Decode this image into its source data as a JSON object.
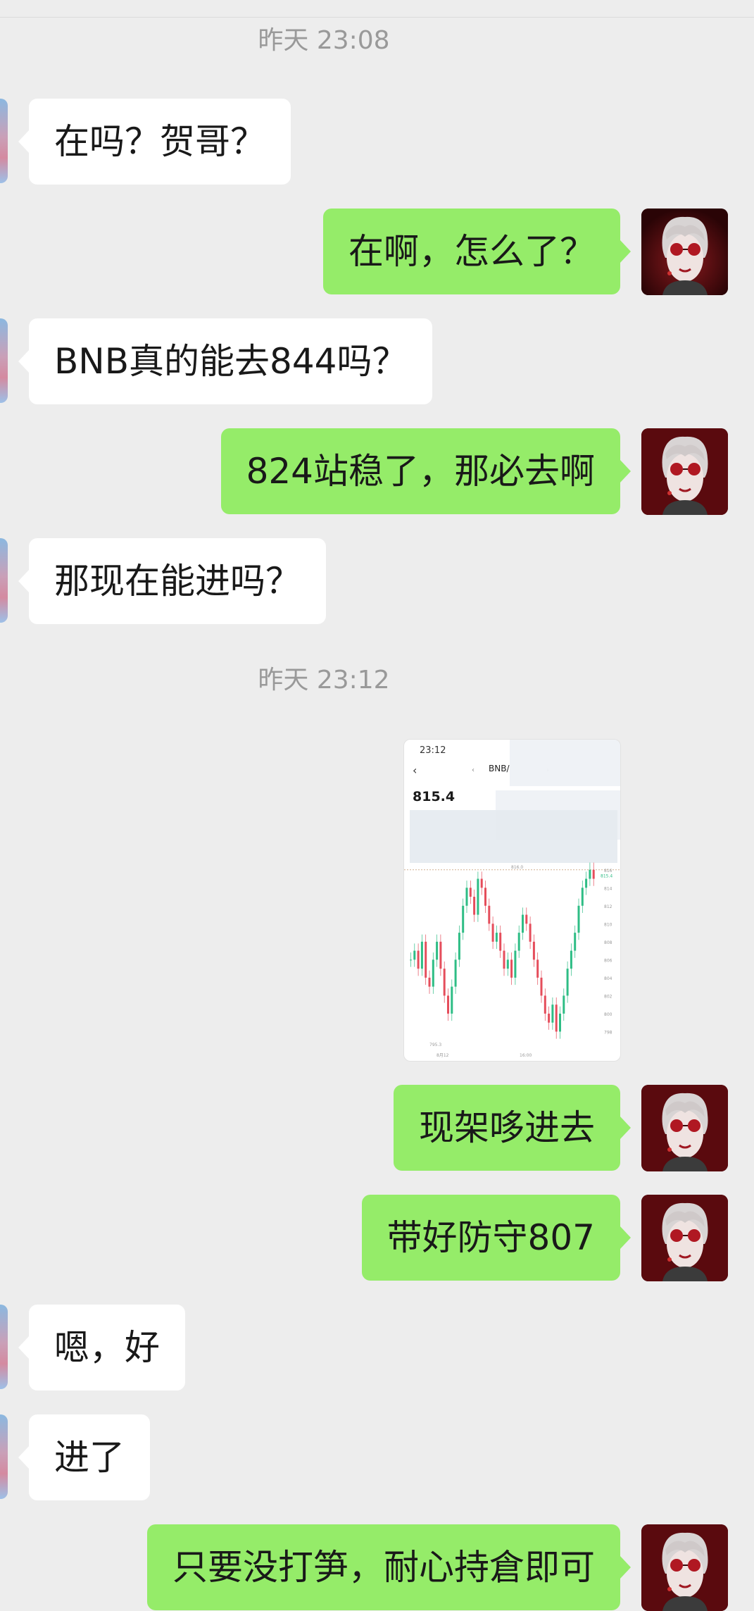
{
  "timestamps": {
    "first": "昨天 23:08",
    "second": "昨天 23:12"
  },
  "messages": [
    {
      "side": "left",
      "text": "在吗？贺哥？"
    },
    {
      "side": "right",
      "text": "在啊，怎么了？"
    },
    {
      "side": "left",
      "text": "BNB真的能去844吗？"
    },
    {
      "side": "right",
      "text": "824站稳了，那必去啊"
    },
    {
      "side": "left",
      "text": "那现在能进吗？"
    },
    {
      "side": "right",
      "text": "现架哆进去"
    },
    {
      "side": "right",
      "text": "带好防守807"
    },
    {
      "side": "left",
      "text": "嗯，好"
    },
    {
      "side": "left",
      "text": "进了"
    },
    {
      "side": "right",
      "text": "只要没打笋，耐心持倉即可"
    }
  ],
  "screenshot": {
    "time": "23:12",
    "back": "‹",
    "prev": "‹",
    "pair": "BNB/",
    "next": "›",
    "price": "815.4",
    "price_tag": "815.4",
    "marker_high": "816.0",
    "low_label": "795.3",
    "x_labels": [
      "8月12",
      "16:00"
    ],
    "y_labels": [
      "816",
      "814",
      "812",
      "810",
      "808",
      "806",
      "804",
      "802",
      "800",
      "798"
    ]
  },
  "colors": {
    "background": "#ededed",
    "bubble_left": "#ffffff",
    "bubble_right": "#95ec69",
    "candle_up": "#2ebd85",
    "candle_down": "#e54d5b"
  }
}
